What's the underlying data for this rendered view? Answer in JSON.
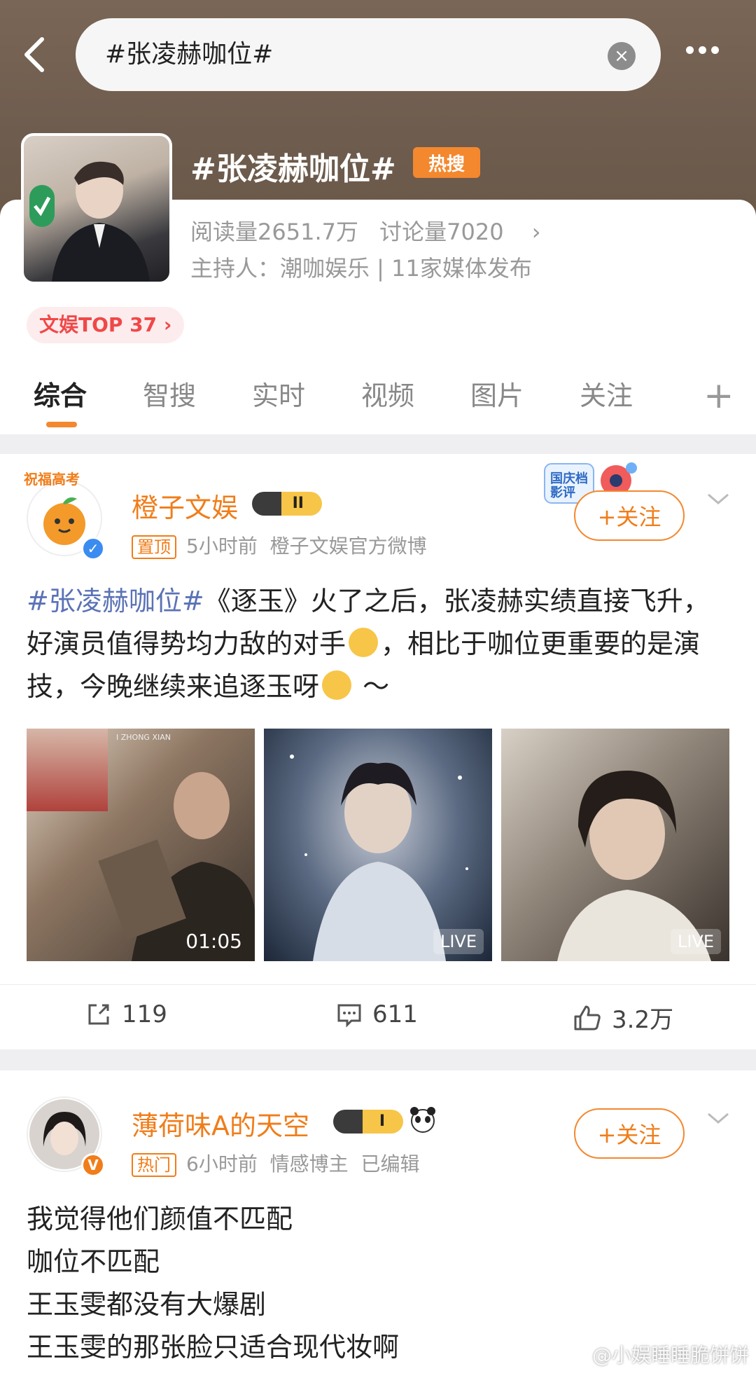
{
  "search": {
    "query": "#张凌赫咖位#"
  },
  "topic": {
    "title": "#张凌赫咖位#",
    "hot_badge": "热搜",
    "reads": "阅读量2651.7万",
    "discussions": "讨论量7020",
    "host": "主持人：潮咖娱乐 | 11家媒体发布",
    "rank": "文娱TOP 37 ›"
  },
  "tabs": [
    "综合",
    "智搜",
    "实时",
    "视频",
    "图片",
    "关注"
  ],
  "tab_plus": "+",
  "post1": {
    "username": "橙子文娱",
    "level": "II",
    "avatar_label": "祝福高考",
    "pin_tag": "置顶",
    "time": "5小时前",
    "source": "橙子文娱官方微博",
    "follow": "+关注",
    "hashtag": "#张凌赫咖位#",
    "text_a": "《逐玉》火了之后，张凌赫实绩直接飞升，好演员值得势均力敌的对手",
    "text_b": "，相比于咖位更重要的是演技，今晚继续来追逐玉呀",
    "text_c": " ～",
    "badge_text": "国庆档影评",
    "media": [
      {
        "label": "01:05",
        "overlay": "I ZHONG XIAN"
      },
      {
        "label": "LIVE"
      },
      {
        "label": "LIVE"
      }
    ],
    "reposts": "119",
    "comments": "611",
    "likes": "3.2万"
  },
  "post2": {
    "username": "薄荷味A的天空",
    "level": "I",
    "hot_tag": "热门",
    "time": "6小时前",
    "category": "情感博主",
    "edited": "已编辑",
    "follow": "+关注",
    "lines": [
      "我觉得他们颜值不匹配",
      "咖位不匹配",
      "王玉雯都没有大爆剧",
      "王玉雯的那张脸只适合现代妆啊"
    ]
  },
  "watermark": "@小娱睡睡脆饼饼",
  "colors": {
    "accent": "#f3882f",
    "link": "#5b72b5",
    "rank": "#f04848"
  }
}
